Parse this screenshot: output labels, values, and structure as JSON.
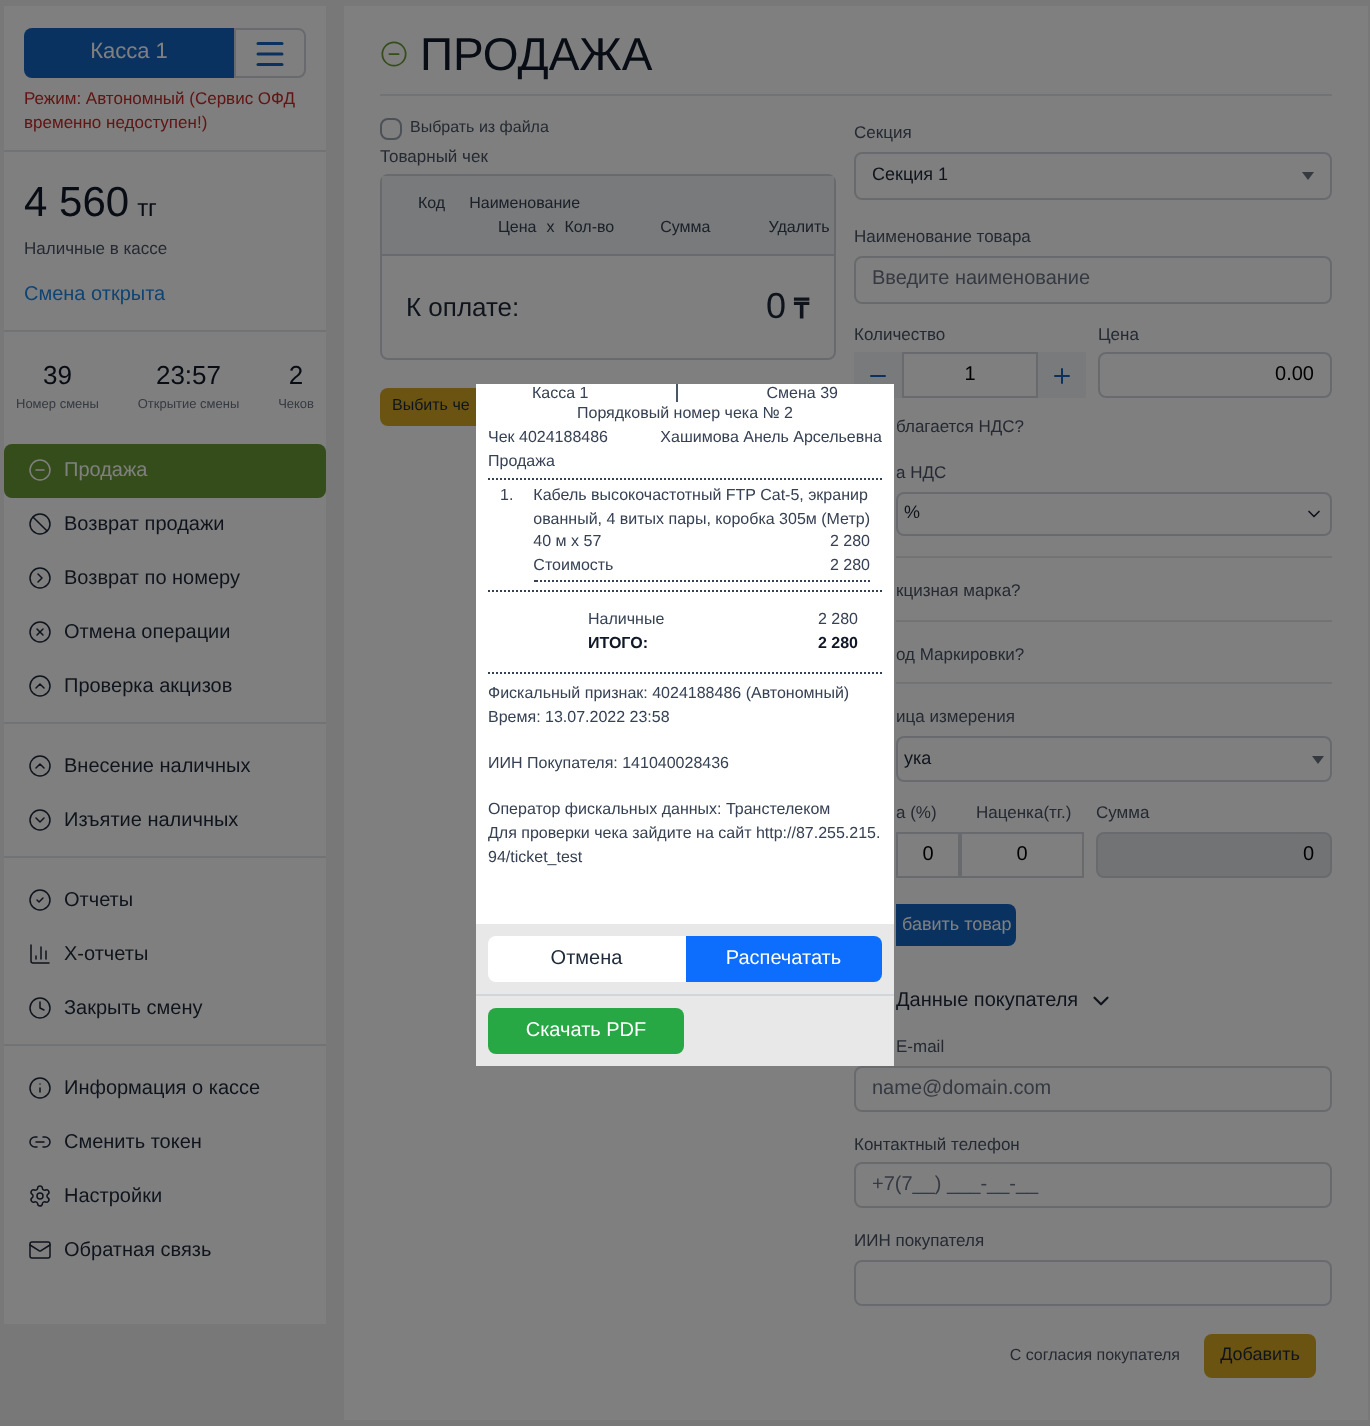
{
  "sidebar": {
    "cashbox_button": "Касса 1",
    "mode_warning": "Режим: Автономный (Сервис ОФД временно недоступен!)",
    "cash_amount": "4 560",
    "cash_currency": "тг",
    "cash_label": "Наличные в кассе",
    "shift_status": "Смена открыта",
    "stats": [
      {
        "value": "39",
        "label": "Номер смены"
      },
      {
        "value": "23:57",
        "label": "Открытие смены"
      },
      {
        "value": "2",
        "label": "Чеков"
      }
    ],
    "menu_groups": [
      {
        "items": [
          {
            "label": "Продажа",
            "selected": true
          },
          {
            "label": "Возврат продажи",
            "selected": false
          },
          {
            "label": "Возврат по номеру",
            "selected": false
          },
          {
            "label": "Отмена операции",
            "selected": false
          },
          {
            "label": "Проверка акцизов",
            "selected": false
          }
        ]
      },
      {
        "items": [
          {
            "label": "Внесение наличных",
            "selected": false
          },
          {
            "label": "Изъятие наличных",
            "selected": false
          }
        ]
      },
      {
        "items": [
          {
            "label": "Отчеты",
            "selected": false
          },
          {
            "label": "X-отчеты",
            "selected": false
          },
          {
            "label": "Закрыть смену",
            "selected": false
          }
        ]
      },
      {
        "items": [
          {
            "label": "Информация о кассе",
            "selected": false
          },
          {
            "label": "Сменить токен",
            "selected": false
          },
          {
            "label": "Настройки",
            "selected": false
          },
          {
            "label": "Обратная связь",
            "selected": false
          }
        ]
      }
    ]
  },
  "main": {
    "title": "ПРОДАЖА",
    "file_checkbox": {
      "label": "Выбрать из файла",
      "checked": false
    },
    "receipt_label": "Товарный чек",
    "table": {
      "columns": [
        "Код",
        "Наименование",
        "Цена",
        "x",
        "Кол-во",
        "Сумма",
        "Удалить"
      ]
    },
    "total_label": "К оплате:",
    "total_value": "0",
    "total_currency": "₸",
    "issue_button": "Выбить че",
    "form": {
      "section_label": "Секция",
      "section_value": "Секция 1",
      "name_label": "Наименование товара",
      "name_placeholder": "Введите наименование",
      "qty_label": "Количество",
      "qty_value": "1",
      "price_label": "Цена",
      "price_value": "0.00",
      "vat_question": "благается НДС?",
      "vat_rate_label": "а НДС",
      "vat_rate_value": "%",
      "excise_question": "кцизная марка?",
      "marking_question": "од Маркировки?",
      "unit_label": "ица измерения",
      "unit_value": "ука",
      "markup_pct_label": "а (%)",
      "markup_label": "Наценка(тг.)",
      "sum_label": "Сумма",
      "markup_pct_value": "0",
      "markup_value": "0",
      "sum_value": "0",
      "add_item_button": "бавить товар",
      "buyer_toggle": "Данные покупателя",
      "email_label": "E-mail",
      "email_placeholder": "name@domain.com",
      "phone_label": "Контактный телефон",
      "phone_placeholder": "+7(7__) ___-__-__",
      "iin_label": "ИИН покупателя",
      "consent_text": "С согласия покупателя",
      "add_button": "Добавить"
    }
  },
  "receipt_dialog": {
    "cashbox": "Касса 1",
    "shift": "Смена 39",
    "number": "Порядковый номер чека № 2",
    "check": "Чек 4024188486",
    "cashier": "Хашимова Анель Арсельевна",
    "operation": "Продажа",
    "items": [
      {
        "num": "1.",
        "name": "Кабель высокочастотный FTP Cat-5, экранированный, 4 витых пары, коробка 305м (Метр)",
        "qty_line": "40 м x 57",
        "qty_sum": "2 280",
        "cost_label": "Стоимость",
        "cost": "2 280"
      }
    ],
    "totals": [
      {
        "kind": "payment",
        "label": "Наличные",
        "value": "2 280"
      },
      {
        "kind": "total",
        "label": "ИТОГО:",
        "value": "2 280"
      }
    ],
    "fiscal_lines": [
      "Фискальный признак: 4024188486 (Автономный)",
      "Время: 13.07.2022 23:58"
    ],
    "buyer_iin": "ИИН Покупателя: 141040028436",
    "operator_lines": [
      "Оператор фискальных данных: Транстелеком",
      "Для проверки чека зайдите на сайт http://87.255.215.94/ticket_test"
    ],
    "cancel_button": "Отмена",
    "print_button": "Распечатать",
    "pdf_button": "Скачать PDF"
  }
}
